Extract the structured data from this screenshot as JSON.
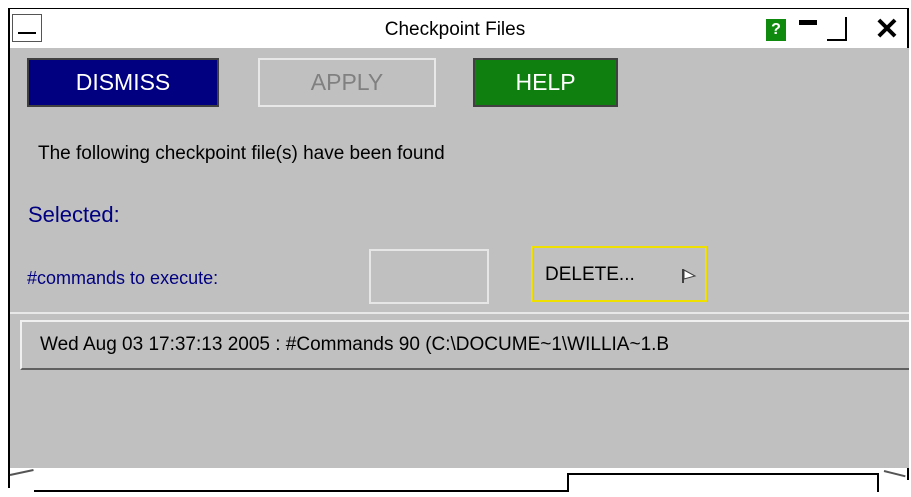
{
  "window": {
    "title": "Checkpoint Files",
    "help_icon": "question-mark-icon",
    "help_glyph": "?",
    "minimize_icon": "minimize-icon",
    "maximize_icon": "maximize-icon",
    "close_icon": "close-icon",
    "close_glyph": "✕",
    "menu_icon": "window-menu-icon"
  },
  "toolbar": {
    "dismiss_label": "DISMISS",
    "apply_label": "APPLY",
    "help_label": "HELP"
  },
  "main": {
    "info_text": "The following checkpoint file(s) have been found",
    "selected_label": "Selected:",
    "commands_label": "#commands to execute:",
    "commands_value": "",
    "delete_label": "DELETE...",
    "delete_icon": "flag-icon"
  },
  "list": {
    "items": [
      "Wed Aug 03 17:37:13 2005 : #Commands 90  (C:\\DOCUME~1\\WILLIA~1.B"
    ]
  },
  "colors": {
    "panel_bg": "#c0c0c0",
    "dismiss_bg": "#000080",
    "help_bg": "#0f7f0f",
    "label_blue": "#000080",
    "delete_border": "#f0e000"
  }
}
